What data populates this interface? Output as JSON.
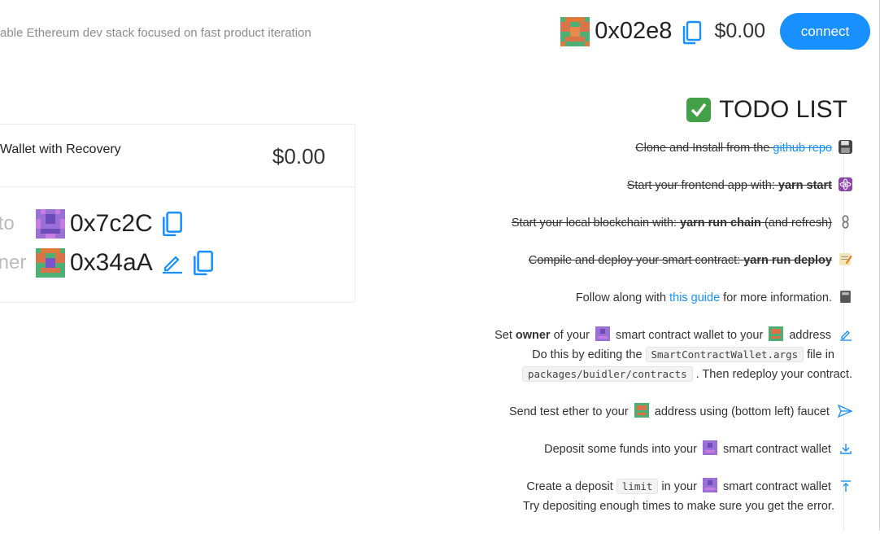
{
  "header": {
    "subtitle": "able Ethereum dev stack focused on fast product iteration",
    "address": "0x02e8",
    "balance": "$0.00",
    "connect_label": "connect"
  },
  "wallet_card": {
    "title": "t Wallet with Recovery",
    "balance": "$0.00",
    "to_label": "to:",
    "to_address": "0x7c2C",
    "owner_label": "ner:",
    "owner_address": "0x34aA"
  },
  "todo": {
    "title": "TODO LIST",
    "items": [
      {
        "pre": "Clone and Install from the ",
        "link": "github repo",
        "post": ""
      },
      {
        "pre": "Start your frontend app with: ",
        "bold": "yarn start",
        "post": ""
      },
      {
        "pre": "Start your local blockchain with: ",
        "bold": "yarn run chain",
        "post": " (and refresh)"
      },
      {
        "pre": "Compile and deploy your smart contract: ",
        "bold": "yarn run deploy",
        "post": ""
      },
      {
        "pre": "Follow along with ",
        "link": "this guide",
        "post": " for more information."
      },
      {
        "a": "Set ",
        "b": "owner",
        "c": " of your ",
        "d": " smart contract wallet to your ",
        "e": " address",
        "line2_pre": "Do this by editing the",
        "code1": "SmartContractWallet.args",
        "line2_post": "file in",
        "code2": "packages/buidler/contracts",
        "line3_post": ". Then redeploy your contract."
      },
      {
        "pre": "Send test ether to your ",
        "post": " address using (bottom left) faucet"
      },
      {
        "pre": "Deposit some funds into your ",
        "post": " smart contract wallet"
      },
      {
        "pre": "Create a deposit",
        "code": "limit",
        "mid": "in your ",
        "post": " smart contract wallet",
        "line2": "Try depositing enough times to make sure you get the error."
      }
    ]
  },
  "colors": {
    "accent": "#1890ff",
    "check": "#43a047"
  }
}
